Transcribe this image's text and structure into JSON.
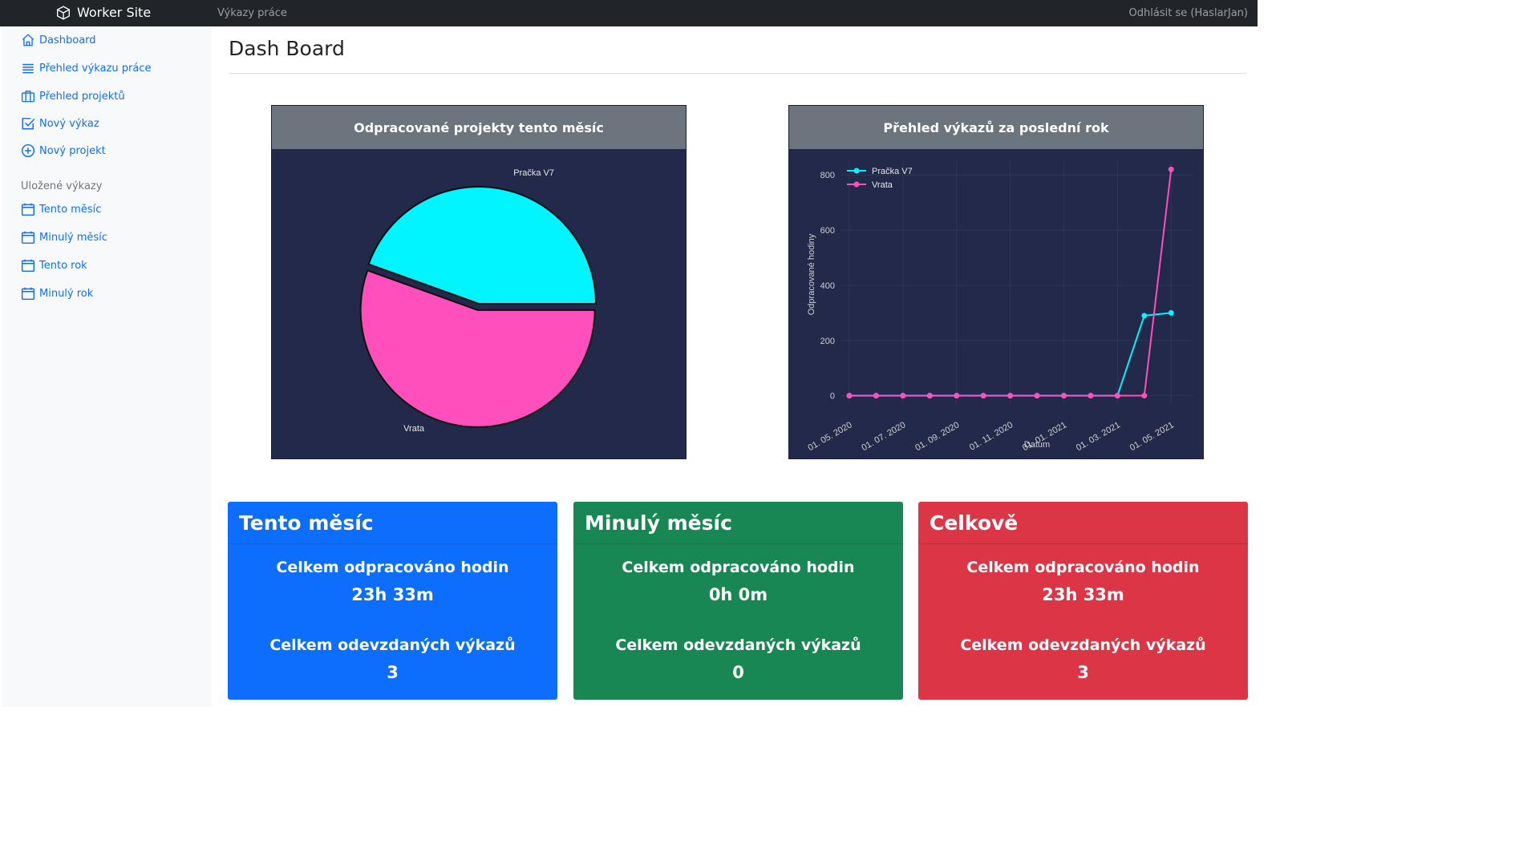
{
  "app": {
    "brand": "Worker Site",
    "nav_link": "Výkazy práce",
    "logout": "Odhlásit se (HaslarJan)"
  },
  "sidebar": {
    "items": [
      {
        "label": "Dashboard",
        "icon": "house-icon"
      },
      {
        "label": "Přehled výkazu práce",
        "icon": "list-icon"
      },
      {
        "label": "Přehled projektů",
        "icon": "briefcase-icon"
      },
      {
        "label": "Nový výkaz",
        "icon": "check-square-icon"
      },
      {
        "label": "Nový projekt",
        "icon": "plus-circle-icon"
      }
    ],
    "saved_heading": "Uložené výkazy",
    "saved_items": [
      {
        "label": "Tento měsíc",
        "icon": "calendar-icon"
      },
      {
        "label": "Minulý měsíc",
        "icon": "calendar-icon"
      },
      {
        "label": "Tento rok",
        "icon": "calendar-icon"
      },
      {
        "label": "Minulý rok",
        "icon": "calendar-icon"
      }
    ]
  },
  "main": {
    "title": "Dash Board"
  },
  "pie_card": {
    "title": "Odpracované projekty tento měsíc"
  },
  "line_card": {
    "title": "Přehled výkazů za poslední rok"
  },
  "colors": {
    "cyan": "#00f5ff",
    "pink": "#ff4fbd",
    "plot_bg": "#22294a",
    "blue": "#0d6efd",
    "green": "#198754",
    "red": "#dc3545"
  },
  "chart_data": [
    {
      "type": "pie",
      "labels": [
        "Pračka V7",
        "Vrata"
      ],
      "values": [
        0.445,
        0.555
      ],
      "colors": [
        "#00f5ff",
        "#ff4fbd"
      ]
    },
    {
      "type": "line",
      "xlabel": "Datum",
      "ylabel": "Odpracované hodiny",
      "ylim": [
        -30,
        850
      ],
      "yticks": [
        0,
        200,
        400,
        600,
        800
      ],
      "xtick_labels": [
        "01. 05. 2020",
        "01. 07. 2020",
        "01. 09. 2020",
        "01. 11. 2020",
        "01. 01. 2021",
        "01. 03. 2021",
        "01. 05. 2021"
      ],
      "legend_position": "top-left",
      "x": [
        0,
        1,
        2,
        3,
        4,
        5,
        6,
        7,
        8,
        9,
        10,
        11,
        12
      ],
      "series": [
        {
          "name": "Pračka V7",
          "color": "#00f5ff",
          "values": [
            0,
            0,
            0,
            0,
            0,
            0,
            0,
            0,
            0,
            0,
            0,
            290,
            300
          ]
        },
        {
          "name": "Vrata",
          "color": "#ff4fbd",
          "values": [
            0,
            0,
            0,
            0,
            0,
            0,
            0,
            0,
            0,
            0,
            0,
            0,
            820
          ]
        }
      ]
    }
  ],
  "stats": [
    {
      "title": "Tento měsíc",
      "hours_label": "Celkem odpracováno hodin",
      "hours": "23h 33m",
      "reports_label": "Celkem odevzdaných výkazů",
      "reports": "3"
    },
    {
      "title": "Minulý měsíc",
      "hours_label": "Celkem odpracováno hodin",
      "hours": "0h 0m",
      "reports_label": "Celkem odevzdaných výkazů",
      "reports": "0"
    },
    {
      "title": "Celkově",
      "hours_label": "Celkem odpracováno hodin",
      "hours": "23h 33m",
      "reports_label": "Celkem odevzdaných výkazů",
      "reports": "3"
    }
  ]
}
